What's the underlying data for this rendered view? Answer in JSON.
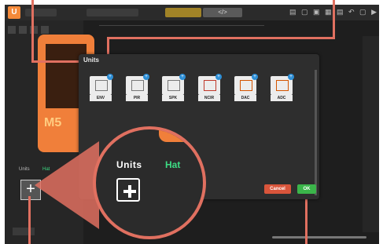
{
  "dialog": {
    "title": "Units",
    "units": [
      {
        "label": "ENV",
        "icon": "env-sensor-icon"
      },
      {
        "label": "PIR",
        "icon": "pir-sensor-icon"
      },
      {
        "label": "SPK",
        "icon": "speaker-icon"
      },
      {
        "label": "NCIR",
        "icon": "ncir-sensor-icon"
      },
      {
        "label": "DAC",
        "icon": "dac-icon"
      },
      {
        "label": "ADC",
        "icon": "adc-icon"
      }
    ],
    "cancel_label": "Cancel",
    "ok_label": "OK"
  },
  "magnifier": {
    "units_label": "Units",
    "hat_label": "Hat",
    "add_icon": "plus-icon"
  },
  "background": {
    "mini_units": "Units",
    "mini_hat": "Hat"
  },
  "colors": {
    "accent": "#e07060",
    "ok": "#3bb54a",
    "cancel": "#d9553b",
    "hat_green": "#3ddc84",
    "device_orange": "#f07f3a"
  }
}
